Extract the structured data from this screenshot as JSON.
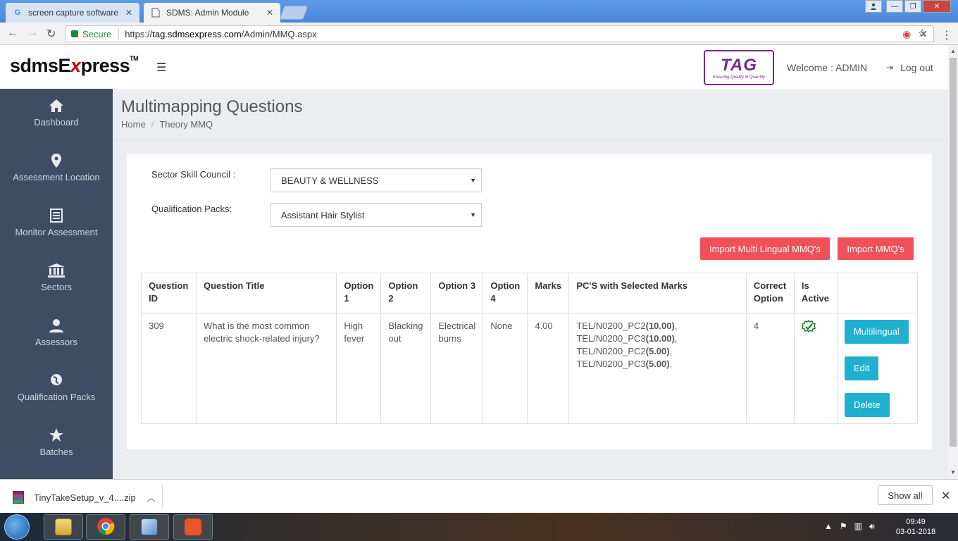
{
  "browser": {
    "tabs": [
      {
        "label": "screen capture software",
        "favicon": "G"
      },
      {
        "label": "SDMS: Admin Module",
        "favicon": "doc"
      }
    ],
    "address": {
      "secure_label": "Secure",
      "url_scheme": "https://",
      "url_host": "tag.sdmsexpress.com",
      "url_path": "/Admin/MMQ.aspx"
    }
  },
  "header": {
    "brand_prefix": "sdmsE",
    "brand_x": "x",
    "brand_suffix": "press",
    "brand_tm": "TM",
    "partner_logo_text": "TAG",
    "partner_logo_tagline": "Ensuring Quality in Quantity",
    "welcome": "Welcome : ADMIN",
    "logout": "Log out"
  },
  "sidebar": {
    "items": [
      {
        "label": "Dashboard",
        "icon": "home-icon"
      },
      {
        "label": "Assessment Location",
        "icon": "map-marker-icon"
      },
      {
        "label": "Monitor Assessment",
        "icon": "list-alt-icon"
      },
      {
        "label": "Sectors",
        "icon": "bank-icon"
      },
      {
        "label": "Assessors",
        "icon": "user-icon"
      },
      {
        "label": "Qualification Packs",
        "icon": "globe-icon"
      },
      {
        "label": "Batches",
        "icon": "star-icon"
      }
    ]
  },
  "page": {
    "title": "Multimapping Questions",
    "breadcrumb": [
      "Home",
      "Theory MMQ"
    ]
  },
  "form": {
    "ssc_label": "Sector Skill Council :",
    "ssc_value": "BEAUTY & WELLNESS",
    "qp_label": "Qualification Packs:",
    "qp_value": "Assistant Hair Stylist"
  },
  "actions": {
    "import_multilingual": "Import Multi Lingual MMQ's",
    "import_mmq": "Import MMQ's"
  },
  "table": {
    "headers": {
      "qid": [
        "Question",
        "ID"
      ],
      "title": "Question Title",
      "opt1": [
        "Option",
        "1"
      ],
      "opt2": [
        "Option",
        "2"
      ],
      "opt3": "Option 3",
      "opt4": [
        "Option",
        "4"
      ],
      "marks": "Marks",
      "pcs": "PC'S with Selected Marks",
      "correct": [
        "Correct",
        "Option"
      ],
      "active": [
        "Is",
        "Active"
      ]
    },
    "rows": [
      {
        "id": "309",
        "title": "What is the most common electric shock-related injury?",
        "option1": "High fever",
        "option2": "Blacking out",
        "option3": "Electrical burns",
        "option4": "None",
        "marks": "4.00",
        "pcs": [
          {
            "code": "TEL/N0200_PC2",
            "marks": "(10.00)"
          },
          {
            "code": "TEL/N0200_PC3",
            "marks": "(10.00)"
          },
          {
            "code": "TEL/N0200_PC2",
            "marks": "(5.00)"
          },
          {
            "code": "TEL/N0200_PC3",
            "marks": "(5.00)"
          }
        ],
        "pc_sep": ",",
        "correct": "4",
        "active": true,
        "buttons": {
          "multilingual": "Multilingual",
          "edit": "Edit",
          "delete": "Delete"
        }
      }
    ]
  },
  "download_bar": {
    "file": "TinyTakeSetup_v_4....zip",
    "show_all": "Show all"
  },
  "taskbar": {
    "time": "09:49",
    "date": "03-01-2018"
  },
  "colors": {
    "sidebar_bg": "#3e4d63",
    "accent_red": "#f0505a",
    "accent_cyan": "#1fb0cf",
    "brand_purple": "#7a2a8a"
  }
}
